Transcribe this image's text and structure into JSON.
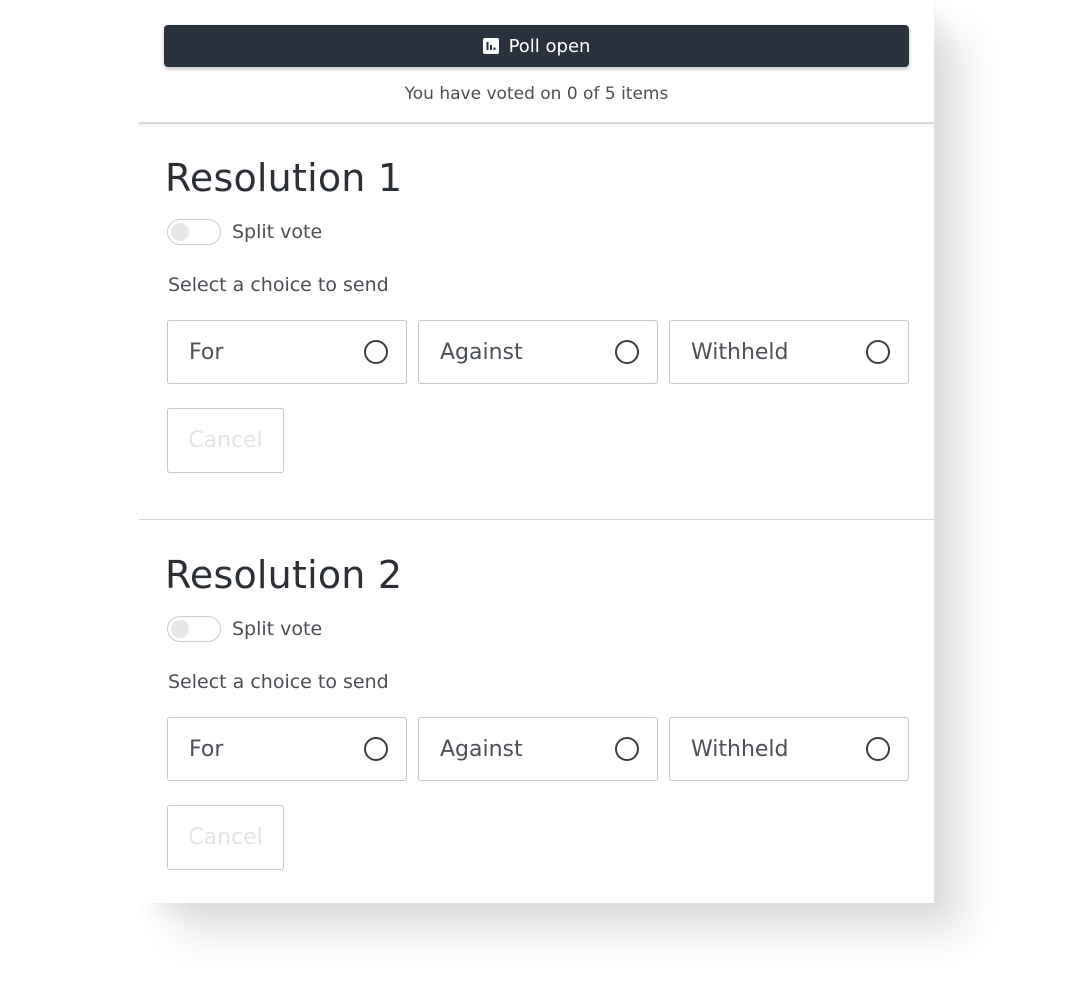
{
  "header": {
    "poll_status": "Poll open",
    "poll_icon": "bar-chart-icon",
    "vote_progress": "You have voted on 0 of 5 items"
  },
  "colors": {
    "header_bg": "#2a323d",
    "header_text": "#ffffff",
    "border": "#c4c6c9",
    "disabled_text": "#e2e4e6"
  },
  "resolutions": [
    {
      "title": "Resolution 1",
      "split_vote_label": "Split vote",
      "split_vote_on": false,
      "prompt": "Select a choice to send",
      "choices": [
        "For",
        "Against",
        "Withheld"
      ],
      "cancel_label": "Cancel",
      "cancel_disabled": true
    },
    {
      "title": "Resolution 2",
      "split_vote_label": "Split vote",
      "split_vote_on": false,
      "prompt": "Select a choice to send",
      "choices": [
        "For",
        "Against",
        "Withheld"
      ],
      "cancel_label": "Cancel",
      "cancel_disabled": true
    }
  ]
}
